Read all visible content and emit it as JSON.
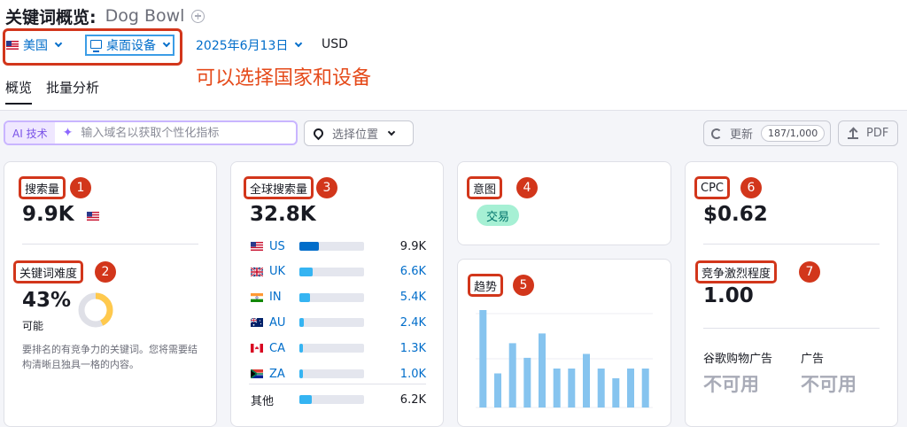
{
  "header": {
    "title": "关键词概览:",
    "keyword": "Dog Bowl"
  },
  "filters": {
    "country": "美国",
    "device": "桌面设备",
    "date": "2025年6月13日",
    "currency": "USD"
  },
  "annotation": "可以选择国家和设备",
  "tabs": [
    {
      "label": "概览",
      "active": true
    },
    {
      "label": "批量分析",
      "active": false
    }
  ],
  "toolbar": {
    "ai_tag": "AI 技术",
    "ai_placeholder": "输入域名以获取个性化指标",
    "location": "选择位置",
    "refresh": "更新",
    "refresh_count": "187/1,000",
    "pdf": "PDF"
  },
  "colors": {
    "highlight": "#d2361b",
    "link": "#006dca",
    "bar_dark": "#006dca",
    "bar_light": "#35b4f2",
    "donut": "#ffc94d",
    "trend_bar": "#86c4ef"
  },
  "volume": {
    "label": "搜索量",
    "badge": "1",
    "value": "9.9K",
    "flag": "us-flag"
  },
  "difficulty": {
    "label": "关键词难度",
    "badge": "2",
    "value": "43%",
    "level": "可能",
    "percent": 43,
    "description": "要排名的有竞争力的关键词。您将需要结构清晰且独具一格的内容。"
  },
  "global": {
    "label": "全球搜索量",
    "badge": "3",
    "value": "32.8K",
    "countries": [
      {
        "code": "US",
        "value": "9.9K",
        "share": 0.3,
        "flag": "us-flag",
        "dark": true
      },
      {
        "code": "UK",
        "value": "6.6K",
        "share": 0.2,
        "flag": "uk-flag"
      },
      {
        "code": "IN",
        "value": "5.4K",
        "share": 0.16,
        "flag": "in-flag"
      },
      {
        "code": "AU",
        "value": "2.4K",
        "share": 0.07,
        "flag": "au-flag"
      },
      {
        "code": "CA",
        "value": "1.3K",
        "share": 0.04,
        "flag": "ca-flag"
      },
      {
        "code": "ZA",
        "value": "1.0K",
        "share": 0.03,
        "flag": "za-flag"
      }
    ],
    "other": {
      "label": "其他",
      "value": "6.2K",
      "share": 0.19
    }
  },
  "intent": {
    "label": "意图",
    "badge": "4",
    "tag": "交易"
  },
  "trend": {
    "label": "趋势",
    "badge": "5"
  },
  "chart_data": {
    "type": "bar",
    "values": [
      1.0,
      0.35,
      0.66,
      0.51,
      0.76,
      0.4,
      0.4,
      0.55,
      0.4,
      0.3,
      0.4,
      0.4
    ],
    "ylim": [
      0,
      1
    ]
  },
  "cpc": {
    "label": "CPC",
    "badge": "6",
    "value": "$0.62"
  },
  "competition": {
    "label": "竞争激烈程度",
    "badge": "7",
    "value": "1.00"
  },
  "ads": {
    "shopping_label": "谷歌购物广告",
    "shopping_value": "不可用",
    "ads_label": "广告",
    "ads_value": "不可用"
  }
}
